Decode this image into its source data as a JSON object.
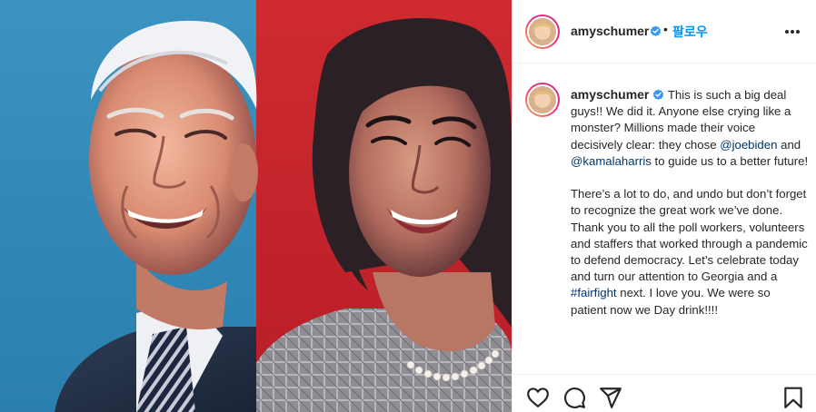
{
  "post": {
    "username": "amyschumer",
    "follow_label": "팔로우",
    "separator": "•",
    "caption": {
      "paragraph1": [
        {
          "type": "text",
          "text": "This is such a big deal guys!! We did it. Anyone else crying like a monster? Millions made their voice decisively clear: they chose "
        },
        {
          "type": "mention",
          "text": "@joebiden"
        },
        {
          "type": "text",
          "text": " and "
        },
        {
          "type": "mention",
          "text": "@kamalaharris"
        },
        {
          "type": "text",
          "text": " to guide us to a better future!"
        }
      ],
      "paragraph2": [
        {
          "type": "text",
          "text": "There’s a lot to do, and undo but don’t forget to recognize the great work we’ve done. Thank you to all the poll workers, volunteers and staffers that worked through a pandemic to defend democracy. Let’s celebrate today and turn our attention to Georgia and a "
        },
        {
          "type": "mention",
          "text": "#fairfight"
        },
        {
          "type": "text",
          "text": " next. I love you. We were so patient now we Day drink!!!!"
        }
      ]
    }
  },
  "icons": {
    "verified": "verified-badge-icon",
    "more": "more-options-icon",
    "like": "heart-icon",
    "comment": "comment-icon",
    "share": "share-icon",
    "save": "bookmark-icon"
  },
  "colors": {
    "link": "#00376b",
    "follow": "#0095f6",
    "verified": "#3897f0",
    "photo_left_bg": "#2f88b6",
    "photo_right_bg": "#c8242c"
  }
}
